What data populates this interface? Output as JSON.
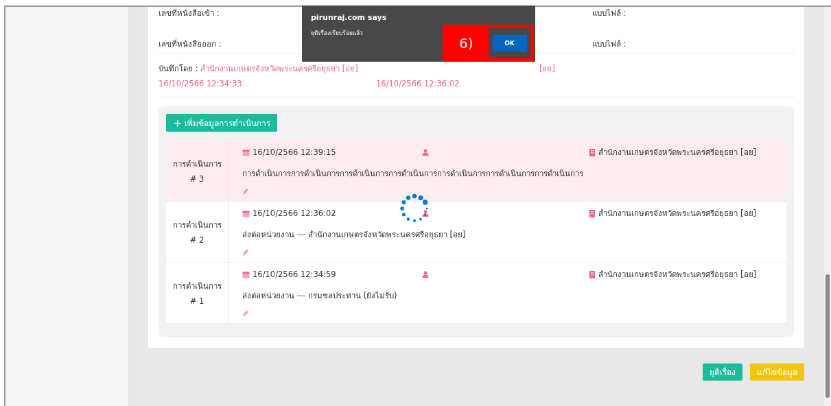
{
  "info_rows": [
    {
      "label": "เลขที่หนังสือเข้า :",
      "file_label": "แบบไฟล์ :"
    },
    {
      "label": "เลขที่หนังสือออก :",
      "file_label": "แบบไฟล์ :"
    }
  ],
  "recorded": {
    "label": "บันทึกโดย :",
    "value": "สำนักงานเกษตรจังหวัดพระนครศรีอยุธยา [อย]",
    "date": "16/10/2566 12:34:33"
  },
  "edited": {
    "value": "[อย]",
    "date": "16/10/2566 12:36:02"
  },
  "add_button": {
    "icon": "+",
    "label": "เพิ่มข้อมูลการดำเนินการ"
  },
  "actions": [
    {
      "label": "การดำเนินการ",
      "number": "# 3",
      "highlighted": true,
      "date": "16/10/2566 12:39:15",
      "text": "การดำเนินการการดำเนินการการดำเนินการการดำเนินการการดำเนินการการดำเนินการการดำเนินการ",
      "office": "สำนักงานเกษตรจังหวัดพระนครศรีอยุธยา [อย]"
    },
    {
      "label": "การดำเนินการ",
      "number": "# 2",
      "highlighted": false,
      "date": "16/10/2566 12:36:02",
      "text": "ส่งต่อหน่วยงาน --- สำนักงานเกษตรจังหวัดพระนครศรีอยุธยา [อย]",
      "office": "สำนักงานเกษตรจังหวัดพระนครศรีอยุธยา [อย]"
    },
    {
      "label": "การดำเนินการ",
      "number": "# 1",
      "highlighted": false,
      "date": "16/10/2566 12:34:59",
      "text": "ส่งต่อหน่วยงาน --- กรมชลประทาน (ยังไม่รับ)",
      "office": "สำนักงานเกษตรจังหวัดพระนครศรีอยุธยา [อย]"
    }
  ],
  "footer_buttons": [
    {
      "label": "ยุติเรื่อง",
      "kind": "close"
    },
    {
      "label": "แก้ไขข้อมูล",
      "kind": "edit"
    }
  ],
  "dialog": {
    "title": "pirunraj.com says",
    "message": "ยุติเรื่องเรียบร้อยแล้ว",
    "button": "OK"
  },
  "annotation": {
    "label": "6)"
  }
}
